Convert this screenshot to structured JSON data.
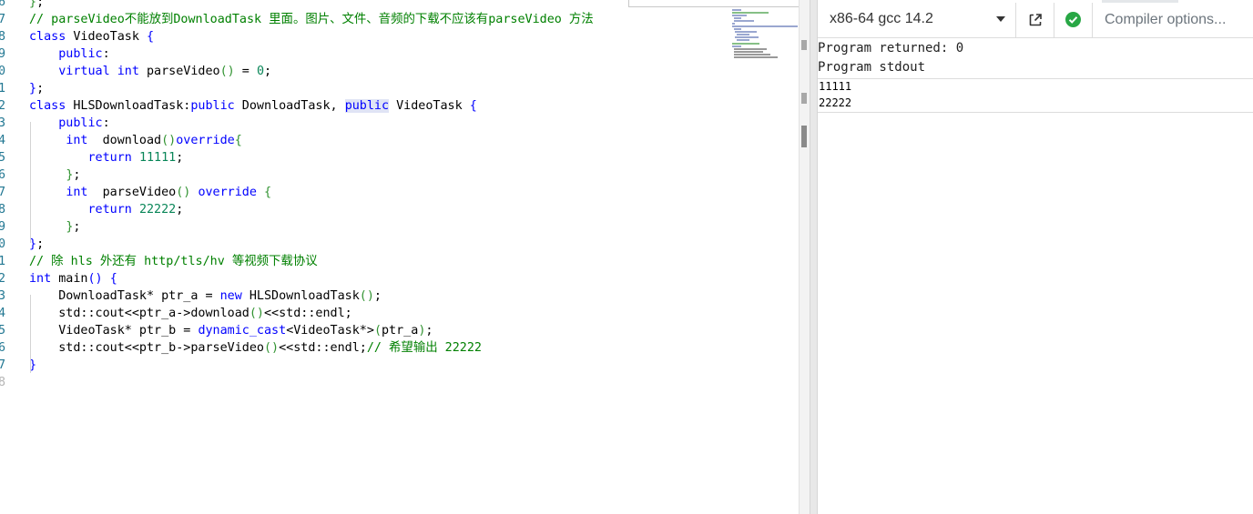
{
  "editor": {
    "lines": [
      {
        "n": "6",
        "html": "<span class=\"p\">}</span>;"
      },
      {
        "n": "7",
        "html": "<span class=\"c\">// parseVideo不能放到DownloadTask 里面。图片、文件、音频的下载不应该有parseVideo 方法</span>"
      },
      {
        "n": "8",
        "html": "<span class=\"k\">class</span> VideoTask <span class=\"k\">{</span>"
      },
      {
        "n": "9",
        "html": "    <span class=\"k\">public</span>:"
      },
      {
        "n": "0",
        "html": "    <span class=\"k\">virtual</span> <span class=\"k\">int</span> parseVideo<span class=\"p\">()</span> = <span class=\"n\">0</span>;"
      },
      {
        "n": "1",
        "html": "<span class=\"k\">}</span>;"
      },
      {
        "n": "2",
        "html": "<span class=\"k\">class</span> HLSDownloadTask:<span class=\"k\">public</span> DownloadTask, <span class=\"k hl\">public</span> VideoTask <span class=\"k\">{</span>"
      },
      {
        "n": "3",
        "html": "    <span class=\"k\">public</span>:"
      },
      {
        "n": "4",
        "html": "     <span class=\"k\">int</span>  download<span class=\"p\">()</span><span class=\"k\">override</span><span class=\"p\">{</span>"
      },
      {
        "n": "5",
        "html": "        <span class=\"k\">return</span> <span class=\"n\">11111</span>;"
      },
      {
        "n": "6",
        "html": "     <span class=\"p\">}</span>;"
      },
      {
        "n": "7",
        "html": "     <span class=\"k\">int</span>  parseVideo<span class=\"p\">()</span> <span class=\"k\">override</span> <span class=\"p\">{</span>"
      },
      {
        "n": "8",
        "html": "        <span class=\"k\">return</span> <span class=\"n\">22222</span>;"
      },
      {
        "n": "9",
        "html": "     <span class=\"p\">}</span>;"
      },
      {
        "n": "0",
        "html": "<span class=\"k\">}</span>;"
      },
      {
        "n": "1",
        "html": "<span class=\"c\">// 除 hls 外还有 http/tls/hv 等视频下载协议</span>"
      },
      {
        "n": "2",
        "html": "<span class=\"k\">int</span> main<span class=\"k\">()</span> <span class=\"k\">{</span>"
      },
      {
        "n": "3",
        "html": "    DownloadTask* ptr_a = <span class=\"k\">new</span> HLSDownloadTask<span class=\"p\">()</span>;"
      },
      {
        "n": "4",
        "html": "    std::cout&lt;&lt;ptr_a-&gt;download<span class=\"p\">()</span>&lt;&lt;std::endl;"
      },
      {
        "n": "5",
        "html": "    VideoTask* ptr_b = <span class=\"k\">dynamic_cast</span>&lt;VideoTask*&gt;<span class=\"p\">(</span>ptr_a<span class=\"p\">)</span>;"
      },
      {
        "n": "6",
        "html": "    std::cout&lt;&lt;ptr_b-&gt;parseVideo<span class=\"p\">()</span>&lt;&lt;std::endl;<span class=\"c\">// 希望输出 22222</span>"
      },
      {
        "n": "7",
        "html": "<span class=\"k\">}</span>"
      },
      {
        "n": "8",
        "html": ""
      }
    ]
  },
  "compiler": {
    "name": "x86-64 gcc 14.2",
    "options_placeholder": "Compiler options..."
  },
  "output": {
    "returned": "Program returned: 0",
    "stdout_label": "Program stdout",
    "stdout_lines": [
      "11111",
      "22222"
    ]
  },
  "colors": {
    "keyword": "#0000ff",
    "comment": "#008000",
    "number": "#098658",
    "line_number": "#237893",
    "success": "#28a745"
  }
}
